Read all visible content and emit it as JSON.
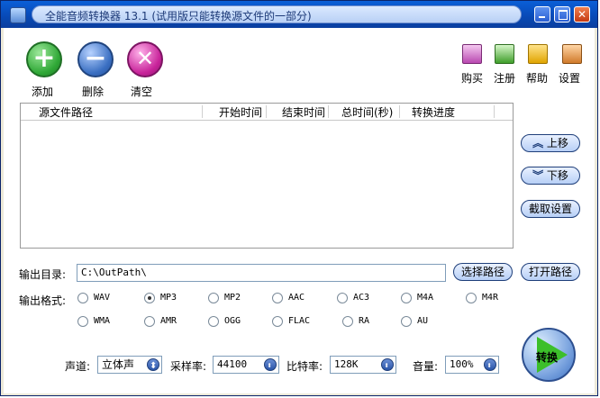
{
  "title": "全能音频转换器 13.1 (试用版只能转换源文件的一部分)",
  "toolbar": {
    "add": "添加",
    "delete": "删除",
    "clear": "清空",
    "buy": "购买",
    "register": "注册",
    "help": "帮助",
    "settings": "设置"
  },
  "table": {
    "columns": [
      "源文件路径",
      "开始时间",
      "结束时间",
      "总时间(秒)",
      "转换进度"
    ],
    "rows": []
  },
  "side": {
    "up": "上移",
    "down": "下移",
    "cut": "截取设置"
  },
  "output": {
    "dir_label": "输出目录:",
    "dir_value": "C:\\OutPath\\",
    "choose": "选择路径",
    "open": "打开路径",
    "format_label": "输出格式:",
    "formats": [
      "WAV",
      "MP3",
      "MP2",
      "AAC",
      "AC3",
      "M4A",
      "M4R",
      "WMA",
      "AMR",
      "OGG",
      "FLAC",
      "RA",
      "AU"
    ],
    "selected_format": "MP3"
  },
  "audio": {
    "channel_label": "声道:",
    "channel_value": "立体声",
    "rate_label": "采样率:",
    "rate_value": "44100",
    "bitrate_label": "比特率:",
    "bitrate_value": "128K",
    "volume_label": "音量:",
    "volume_value": "100%"
  },
  "convert": "转换",
  "colors": {
    "title_blue": "#0a49b5",
    "add_green": "#2fa836",
    "delete_blue": "#3a6fc2",
    "clear_magenta": "#c8239a",
    "convert_green": "#3cbf2a"
  }
}
